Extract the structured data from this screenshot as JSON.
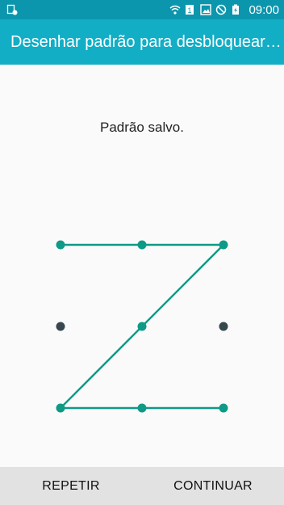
{
  "status_bar": {
    "time": "09:00",
    "icons": [
      "notification-icon",
      "wifi-icon",
      "sim-1-icon",
      "image-icon",
      "do-not-disturb-icon",
      "battery-charging-icon"
    ]
  },
  "app_bar": {
    "title": "Desenhar padrão para desbloquear a..."
  },
  "message": "Padrão salvo.",
  "pattern": {
    "grid": 3,
    "selected_sequence": [
      1,
      2,
      3,
      5,
      7,
      8,
      9
    ],
    "colors": {
      "line": "#0e9a87",
      "dot_active": "#0e9a87",
      "dot_inactive": "#37474f"
    }
  },
  "bottom_bar": {
    "repeat_label": "REPETIR",
    "continue_label": "CONTINUAR"
  }
}
